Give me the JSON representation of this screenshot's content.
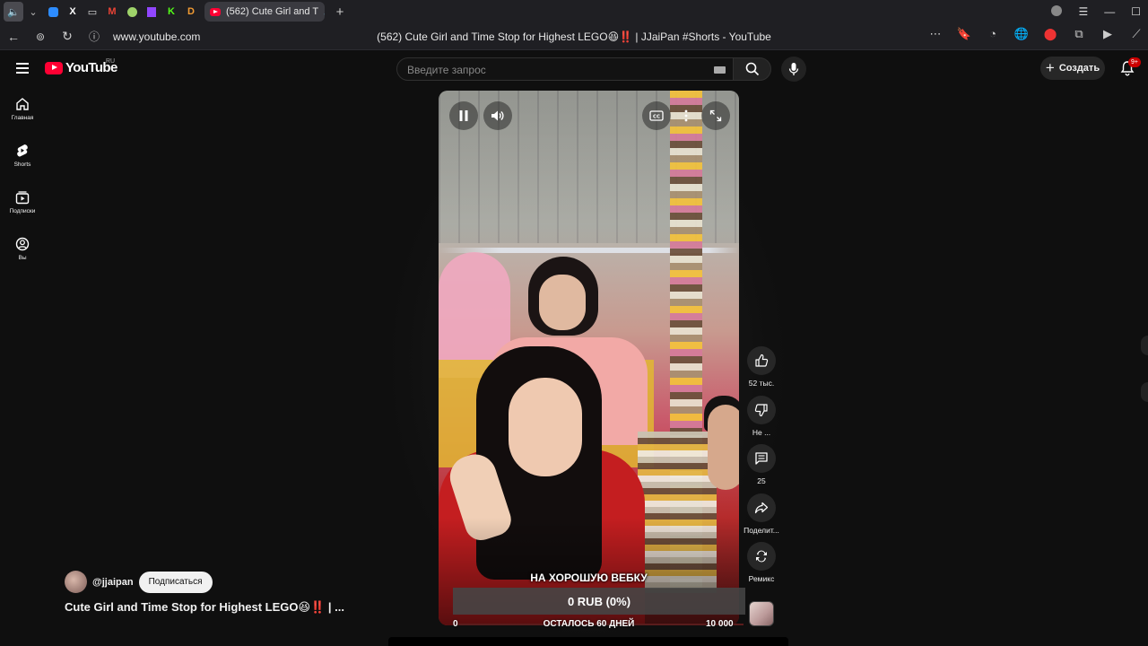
{
  "browser": {
    "pinned_tabs": [
      "speaker-icon",
      "chevron-down-icon",
      "messenger-icon",
      "x-icon",
      "vr-icon",
      "gmail-icon",
      "app-icon",
      "twitch-icon",
      "kick-icon",
      "p-icon"
    ],
    "active_tab": {
      "title": "(562) Cute Girl and T",
      "audio_icon": "speaker-icon"
    },
    "url": "www.youtube.com",
    "page_title": "(562) Cute Girl and Time Stop for Highest LEGO😆‼️ | JJaiPan #Shorts - YouTube"
  },
  "header": {
    "logo_text": "YouTube",
    "region": "RU",
    "search_placeholder": "Введите запрос",
    "create_label": "Создать",
    "notification_count": "9+"
  },
  "sidebar": {
    "items": [
      {
        "label": "Главная",
        "icon": "home-icon"
      },
      {
        "label": "Shorts",
        "icon": "shorts-icon"
      },
      {
        "label": "Подписки",
        "icon": "subscriptions-icon"
      },
      {
        "label": "Вы",
        "icon": "you-icon"
      }
    ]
  },
  "player": {
    "donation": {
      "title": "НА ХОРОШУЮ ВЕБКУ",
      "amount": "0 RUB (0%)",
      "min": "0",
      "remaining": "ОСТАЛОСЬ 60 ДНЕЙ",
      "max": "10 000",
      "progress_fraction": 0.0
    }
  },
  "actions": {
    "likes": "52 тыс.",
    "dislike": "Не ...",
    "comments": "25",
    "share": "Поделит...",
    "remix": "Ремикс"
  },
  "channel": {
    "handle": "@jjaipan",
    "subscribe_label": "Подписаться"
  },
  "short_title": "Cute Girl and Time Stop for Highest LEGO😆‼️ | ...",
  "colors": {
    "accent": "#ff0033",
    "background": "#0f0f0f",
    "badge": "#cc0000"
  }
}
